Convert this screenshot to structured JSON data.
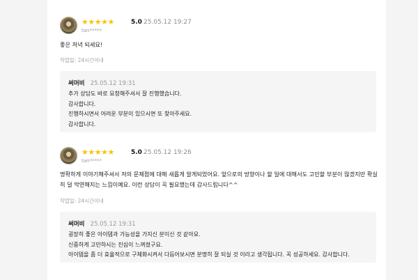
{
  "reviews": [
    {
      "stars": "★★★★★",
      "score": "5.0",
      "date": "25.05.12 19:27",
      "user": "tan*****",
      "text": "좋은 저녁 되세요!",
      "time_ago": "작업일: 24시간이내",
      "reply": {
        "name": "써머비",
        "date": "25.05.12 19:31",
        "lines": [
          "추가 상담도 바로 요청해주셔서 잘 진행했습니다.",
          "감사합니다.",
          "진행하시면서 어려운 부분이 있으시면 또 찾아주세요.",
          "감사합니다."
        ]
      }
    },
    {
      "stars": "★★★★★",
      "score": "5.0",
      "date": "25.05.12 19:26",
      "user": "tan*****",
      "text": "명확하게 이야기해주셔서 저의 문제점에 대해 새롭게 알게되었어요. 앞으로의 방향이나 할 일에 대해서도 고민할 부분이 많겠지만 확실히 덜 막연해지는 느낌이예요. 이런 상담이 꼭 필요했는데 감사드립니다^^",
      "time_ago": "작업일: 24시간이내",
      "reply": {
        "name": "써머비",
        "date": "25.05.12 19:31",
        "lines": [
          "굉장히 좋은 아이템과 가능성을 가지신 분이신 것 같아요.",
          "신중하게 고민하시는 진심이 느껴졌구요.",
          "아이템을 좀 더 효율적으로 구체화시켜서 다듬어보시면 분명히 잘 되실 것 이라고 생각됩니다. 꼭 성공하세요. 감사합니다."
        ]
      }
    }
  ]
}
